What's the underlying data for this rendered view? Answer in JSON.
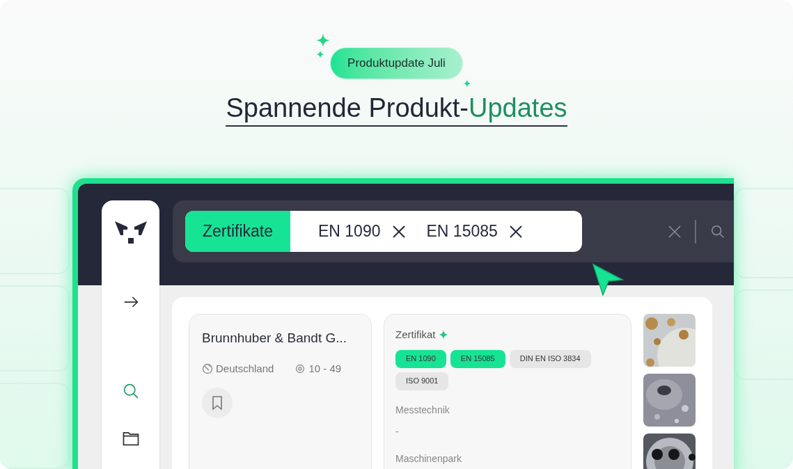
{
  "badge": "Produktupdate Juli",
  "headline": {
    "text": "Spannende Produkt-",
    "highlight": "Updates"
  },
  "sidebar": {
    "items": [
      {
        "kind": "arrow",
        "selected": false
      },
      {
        "kind": "search",
        "selected": true
      },
      {
        "kind": "folder",
        "selected": false
      }
    ]
  },
  "search": {
    "category": "Zertifikate",
    "chips": [
      "EN 1090",
      "EN 15085"
    ]
  },
  "company": {
    "name": "Brunnhuber & Bandt G...",
    "country": "Deutschland",
    "size": "10 - 49"
  },
  "details": {
    "label": "Zertifikat",
    "tags": [
      {
        "label": "EN 1090",
        "selected": true
      },
      {
        "label": "EN 15085",
        "selected": true
      },
      {
        "label": "DIN EN ISO 3834",
        "selected": false
      },
      {
        "label": "ISO 9001",
        "selected": false
      }
    ],
    "sections": [
      {
        "label": "Messtechnik",
        "value": "-"
      },
      {
        "label": "Maschinenpark"
      }
    ]
  }
}
